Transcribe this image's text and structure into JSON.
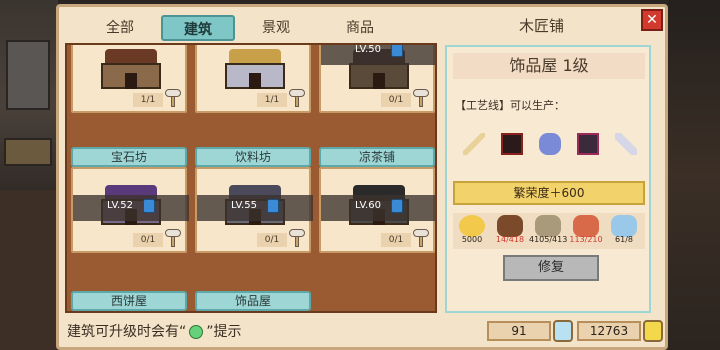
{
  "tabs": [
    {
      "label": "全部",
      "active": false
    },
    {
      "label": "建筑",
      "active": true
    },
    {
      "label": "景观",
      "active": false
    },
    {
      "label": "商品",
      "active": false
    }
  ],
  "window": {
    "title": "木匠铺",
    "close_icon": "close-icon"
  },
  "grid": {
    "row1": [
      {
        "count": "1/1",
        "locked": false
      },
      {
        "count": "1/1",
        "locked": false
      },
      {
        "count": "0/1",
        "locked": true,
        "level": "LV.50"
      }
    ],
    "row2": [
      {
        "name": "宝石坊",
        "count": "0/1",
        "locked": true,
        "level": "LV.52"
      },
      {
        "name": "饮料坊",
        "count": "0/1",
        "locked": true,
        "level": "LV.55"
      },
      {
        "name": "凉茶铺",
        "count": "0/1",
        "locked": true,
        "level": "LV.60"
      }
    ],
    "row3": [
      {
        "name": "西饼屋"
      },
      {
        "name": "饰品屋"
      }
    ]
  },
  "detail": {
    "title": "饰品屋 1级",
    "subtitle": "【工艺线】可以生产：",
    "prosperity": "繁荣度＋600",
    "resources": [
      {
        "icon": "coin-icon",
        "value": "5000",
        "insufficient": false
      },
      {
        "icon": "wood-icon",
        "value": "14/418",
        "insufficient": true
      },
      {
        "icon": "stone-icon",
        "value": "4105/413",
        "insufficient": false
      },
      {
        "icon": "brick-icon",
        "value": "113/210",
        "insufficient": true
      },
      {
        "icon": "crystal-icon",
        "value": "61/8",
        "insufficient": false
      }
    ],
    "repair_label": "修复"
  },
  "footer": {
    "tip_prefix": "建筑可升级时会有“",
    "tip_suffix": "”提示",
    "gems": "91",
    "coins": "12763"
  },
  "colors": {
    "panel_bg": "#f3e3c8",
    "tab_active": "#7fc6c6",
    "prosperity_bg": "#f2d26a",
    "insufficient": "#d23a2e"
  }
}
